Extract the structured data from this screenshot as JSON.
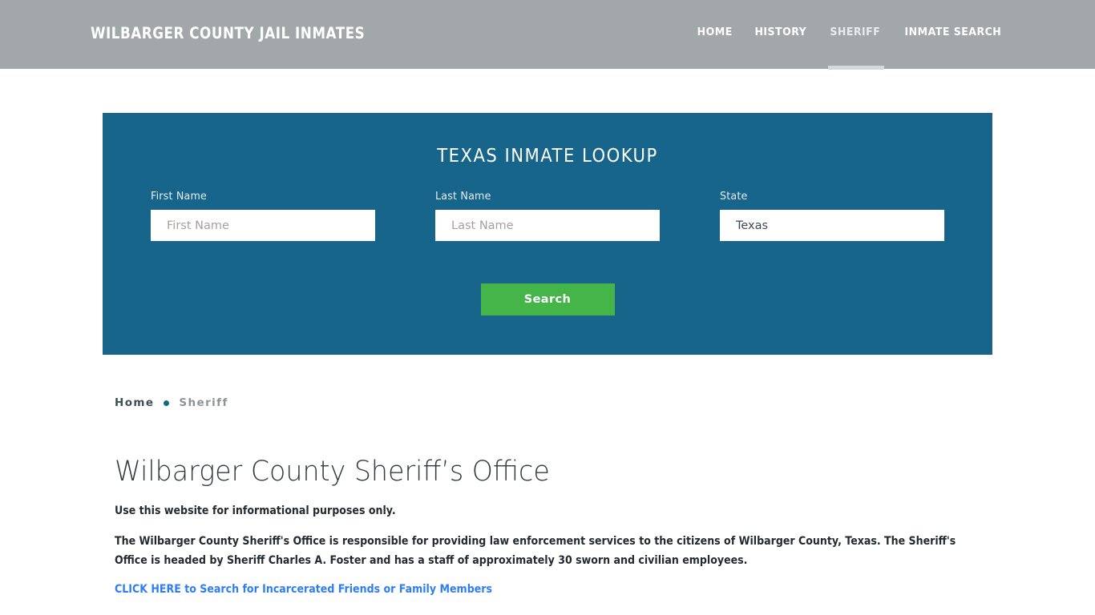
{
  "header": {
    "site_title": "WILBARGER COUNTY JAIL INMATES",
    "background_color": "#a2a7aa",
    "nav": [
      {
        "label": "HOME",
        "active": false
      },
      {
        "label": "HISTORY",
        "active": false
      },
      {
        "label": "SHERIFF",
        "active": true
      },
      {
        "label": "INMATE SEARCH",
        "active": false
      }
    ]
  },
  "search_panel": {
    "title": "TEXAS INMATE LOOKUP",
    "background_color": "#17658b",
    "fields": [
      {
        "label": "First Name",
        "placeholder": "First Name",
        "value": ""
      },
      {
        "label": "Last Name",
        "placeholder": "Last Name",
        "value": ""
      },
      {
        "label": "State",
        "placeholder": "",
        "value": "Texas"
      }
    ],
    "state_options": [
      "Texas"
    ],
    "submit_label": "Search",
    "submit_color": "#45b549"
  },
  "breadcrumb": {
    "home_label": "Home",
    "separator": "•",
    "current_label": "Sheriff",
    "dot_color": "#17658b"
  },
  "main": {
    "page_title": "Wilbarger County Sheriff’s Office",
    "lede": "Use this website for informational purposes only.",
    "paragraph": "The Wilbarger County Sheriff's Office is responsible for providing law enforcement services to the citizens of Wilbarger County, Texas. The Sheriff's Office is headed by Sheriff Charles A. Foster and has a staff of approximately 30 sworn and civilian employees.",
    "cta_link_text": "CLICK HERE to Search for Incarcerated Friends or Family Members",
    "cta_link_color": "#2f7df4"
  }
}
